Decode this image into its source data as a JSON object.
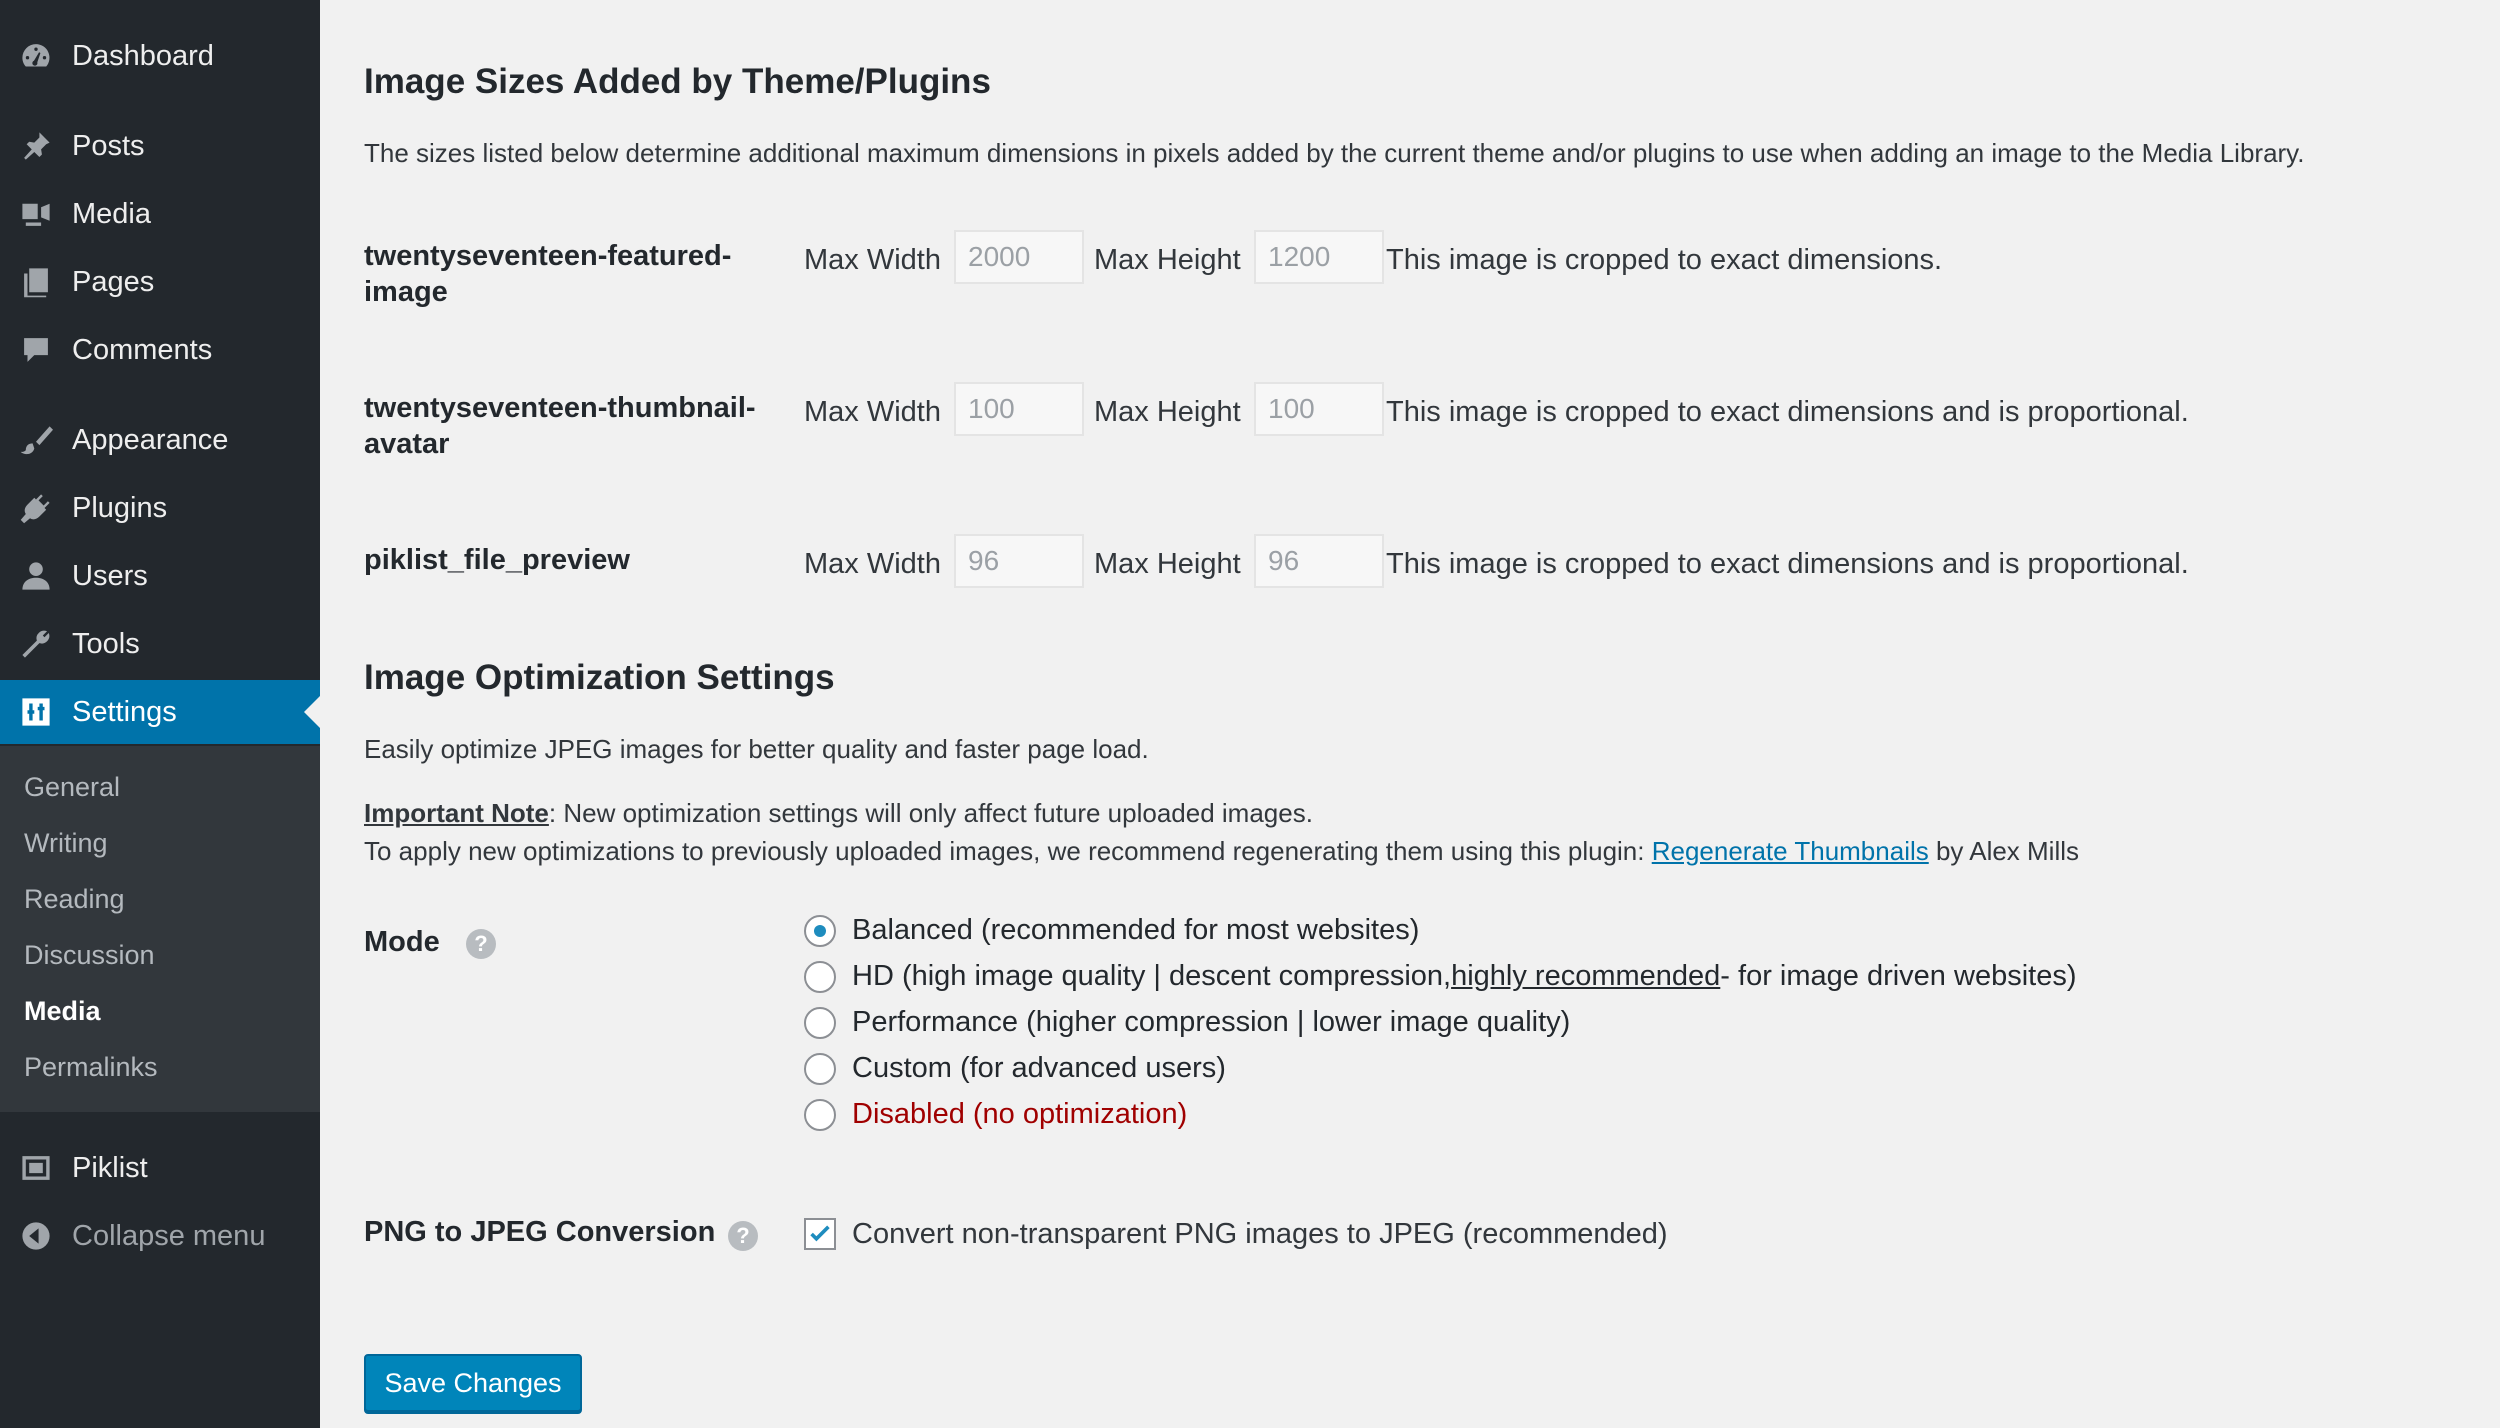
{
  "sidebar": {
    "items": [
      {
        "label": "Dashboard",
        "icon": "dashboard-icon"
      },
      {
        "label": "Posts",
        "icon": "pin-icon"
      },
      {
        "label": "Media",
        "icon": "media-icon"
      },
      {
        "label": "Pages",
        "icon": "pages-icon"
      },
      {
        "label": "Comments",
        "icon": "comment-icon"
      },
      {
        "label": "Appearance",
        "icon": "brush-icon"
      },
      {
        "label": "Plugins",
        "icon": "plug-icon"
      },
      {
        "label": "Users",
        "icon": "user-icon"
      },
      {
        "label": "Tools",
        "icon": "wrench-icon"
      },
      {
        "label": "Settings",
        "icon": "settings-icon"
      },
      {
        "label": "Piklist",
        "icon": "piklist-icon"
      },
      {
        "label": "Collapse menu",
        "icon": "collapse-icon"
      }
    ],
    "submenu": [
      "General",
      "Writing",
      "Reading",
      "Discussion",
      "Media",
      "Permalinks"
    ],
    "current_submenu": "Media"
  },
  "sizes_section": {
    "title": "Image Sizes Added by Theme/Plugins",
    "description": "The sizes listed below determine additional maximum dimensions in pixels added by the current theme and/or plugins to use when adding an image to the Media Library.",
    "max_width_label": "Max Width",
    "max_height_label": "Max Height",
    "rows": [
      {
        "name_line1": "twentyseventeen-featured-",
        "name_line2": "image",
        "width": "2000",
        "height": "1200",
        "note": "This image is cropped to exact dimensions."
      },
      {
        "name_line1": "twentyseventeen-thumbnail-",
        "name_line2": "avatar",
        "width": "100",
        "height": "100",
        "note": "This image is cropped to exact dimensions and is proportional."
      },
      {
        "name_line1": "piklist_file_preview",
        "name_line2": "",
        "width": "96",
        "height": "96",
        "note": "This image is cropped to exact dimensions and is proportional."
      }
    ]
  },
  "optimization": {
    "title": "Image Optimization Settings",
    "description": "Easily optimize JPEG images for better quality and faster page load.",
    "note_label": "Important Note",
    "note_text": ": New optimization settings will only affect future uploaded images.",
    "regen_prefix": "To apply new optimizations to previously uploaded images, we recommend regenerating them using this plugin: ",
    "regen_link": "Regenerate Thumbnails",
    "regen_suffix": " by Alex Mills",
    "mode_label": "Mode",
    "help_glyph": "?",
    "modes": {
      "balanced": "Balanced (recommended for most websites)",
      "hd_prefix": "HD (high image quality | descent compression, ",
      "hd_link": "highly recommended",
      "hd_suffix": " - for image driven websites)",
      "performance": "Performance (higher compression | lower image quality)",
      "custom": "Custom (for advanced users)",
      "disabled": "Disabled (no optimization)"
    },
    "selected_mode": "balanced",
    "png_label": "PNG to JPEG Conversion",
    "png_checkbox": "Convert non-transparent PNG images to JPEG (recommended)",
    "png_checked": true
  },
  "save_button": "Save Changes",
  "colors": {
    "sidebar_bg": "#23282d",
    "submenu_bg": "#32373c",
    "accent": "#0073aa",
    "disabled_red": "#a00000"
  }
}
